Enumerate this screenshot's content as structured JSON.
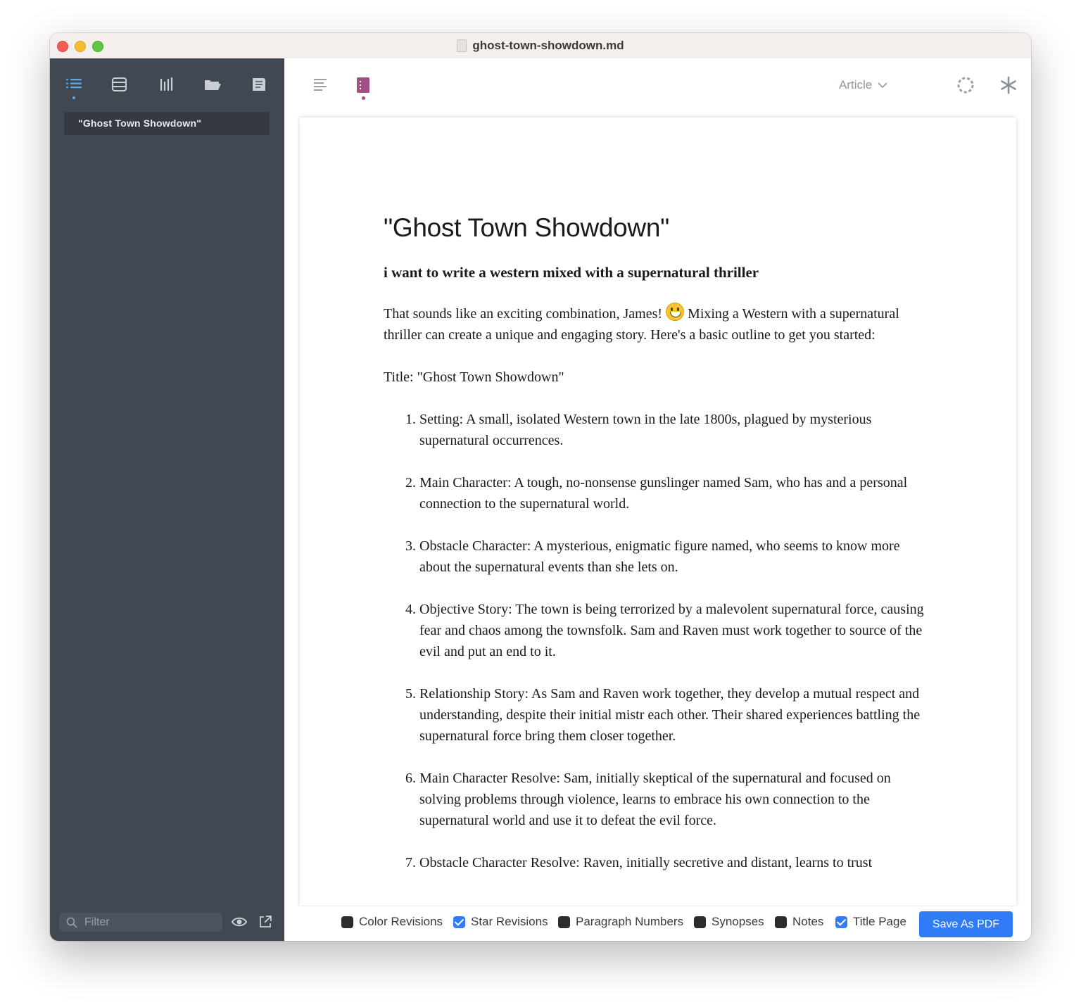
{
  "window": {
    "title": "ghost-town-showdown.md"
  },
  "sidebar": {
    "items": [
      {
        "label": "\"Ghost Town Showdown\""
      }
    ],
    "filter": {
      "placeholder": "Filter",
      "value": ""
    }
  },
  "toolbar": {
    "view_mode": "Article"
  },
  "document": {
    "title": "\"Ghost Town Showdown\"",
    "prompt": "i want to write a western mixed with a supernatural thriller",
    "intro_before_emoji": "That sounds like an exciting combination, James! ",
    "intro_after_emoji": " Mixing a Western with a supernatural thriller can create a unique and engaging story. Here's a basic outline to get you started:",
    "title_line": "Title: \"Ghost Town Showdown\"",
    "outline": [
      "Setting: A small, isolated Western town in the late 1800s, plagued by mysterious supernatural occurrences.",
      "Main Character: A tough, no-nonsense gunslinger named Sam, who has and a personal connection to the supernatural world.",
      "Obstacle Character: A mysterious, enigmatic figure named, who seems to know more about the supernatural events than she lets on.",
      "Objective Story: The town is being terrorized by a malevolent supernatural force, causing fear and chaos among the townsfolk. Sam and Raven must work together to source of the evil and put an end to it.",
      "Relationship Story: As Sam and Raven work together, they develop a mutual respect and understanding, despite their initial mistr each other. Their shared experiences battling the supernatural force bring them closer together.",
      "Main Character Resolve: Sam, initially skeptical of the supernatural and focused on solving problems through violence, learns to embrace his own connection to the supernatural world and use it to defeat the evil force.",
      "Obstacle Character Resolve: Raven, initially secretive and distant, learns to trust"
    ]
  },
  "export_options": {
    "color_revisions": {
      "label": "Color Revisions",
      "checked": false
    },
    "star_revisions": {
      "label": "Star Revisions",
      "checked": true
    },
    "paragraph_numbers": {
      "label": "Paragraph Numbers",
      "checked": false
    },
    "synopses": {
      "label": "Synopses",
      "checked": false
    },
    "notes": {
      "label": "Notes",
      "checked": false
    },
    "title_page": {
      "label": "Title Page",
      "checked": true
    },
    "save_pdf_label": "Save As PDF"
  },
  "colors": {
    "sidebar_bg": "#414852",
    "accent_blue": "#2f7cf6",
    "active_tool_blue": "#5aa8e8",
    "active_tool_magenta": "#a24f86"
  },
  "icons": [
    "outline-icon",
    "index-cards-icon",
    "board-icon",
    "folder-icon",
    "notes-icon",
    "text-align-icon",
    "dialogue-icon",
    "chevron-down-icon",
    "dashed-circle-icon",
    "asterisk-icon",
    "play-circle-icon",
    "search-icon",
    "eye-icon",
    "share-icon",
    "file-icon"
  ]
}
